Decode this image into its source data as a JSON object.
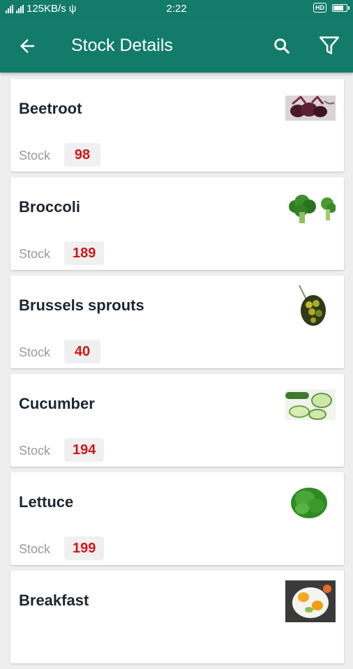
{
  "status_bar": {
    "network_speed": "125KB/s",
    "time": "2:22",
    "hd_label": "HD",
    "icons": [
      "signal-icon",
      "usb-icon",
      "battery-icon"
    ]
  },
  "app_bar": {
    "title": "Stock Details",
    "icons": [
      "back-arrow-icon",
      "search-icon",
      "filter-icon"
    ],
    "color": "#137b6a"
  },
  "stock_label": "Stock",
  "items": [
    {
      "name": "Beetroot",
      "stock": "98",
      "image": "beetroot-image"
    },
    {
      "name": "Broccoli",
      "stock": "189",
      "image": "broccoli-image"
    },
    {
      "name": "Brussels sprouts",
      "stock": "40",
      "image": "brussels-sprouts-image"
    },
    {
      "name": "Cucumber",
      "stock": "194",
      "image": "cucumber-image"
    },
    {
      "name": "Lettuce",
      "stock": "199",
      "image": "lettuce-image"
    },
    {
      "name": "Breakfast",
      "stock": "",
      "image": "breakfast-image"
    }
  ],
  "colors": {
    "accent": "#137b6a",
    "stock_value": "#d0161b"
  }
}
